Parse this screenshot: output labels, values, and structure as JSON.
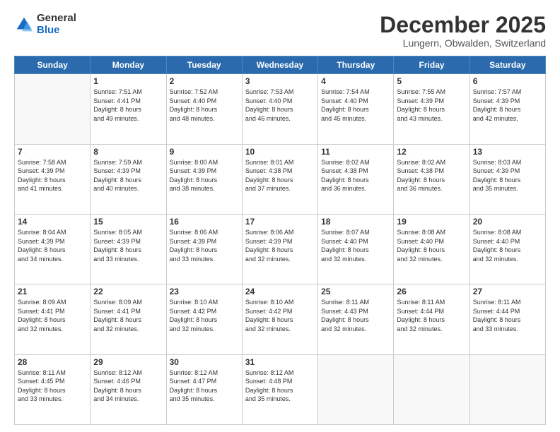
{
  "logo": {
    "general": "General",
    "blue": "Blue"
  },
  "header": {
    "month": "December 2025",
    "location": "Lungern, Obwalden, Switzerland"
  },
  "weekdays": [
    "Sunday",
    "Monday",
    "Tuesday",
    "Wednesday",
    "Thursday",
    "Friday",
    "Saturday"
  ],
  "weeks": [
    [
      {
        "day": "",
        "info": ""
      },
      {
        "day": "1",
        "info": "Sunrise: 7:51 AM\nSunset: 4:41 PM\nDaylight: 8 hours\nand 49 minutes."
      },
      {
        "day": "2",
        "info": "Sunrise: 7:52 AM\nSunset: 4:40 PM\nDaylight: 8 hours\nand 48 minutes."
      },
      {
        "day": "3",
        "info": "Sunrise: 7:53 AM\nSunset: 4:40 PM\nDaylight: 8 hours\nand 46 minutes."
      },
      {
        "day": "4",
        "info": "Sunrise: 7:54 AM\nSunset: 4:40 PM\nDaylight: 8 hours\nand 45 minutes."
      },
      {
        "day": "5",
        "info": "Sunrise: 7:55 AM\nSunset: 4:39 PM\nDaylight: 8 hours\nand 43 minutes."
      },
      {
        "day": "6",
        "info": "Sunrise: 7:57 AM\nSunset: 4:39 PM\nDaylight: 8 hours\nand 42 minutes."
      }
    ],
    [
      {
        "day": "7",
        "info": "Sunrise: 7:58 AM\nSunset: 4:39 PM\nDaylight: 8 hours\nand 41 minutes."
      },
      {
        "day": "8",
        "info": "Sunrise: 7:59 AM\nSunset: 4:39 PM\nDaylight: 8 hours\nand 40 minutes."
      },
      {
        "day": "9",
        "info": "Sunrise: 8:00 AM\nSunset: 4:39 PM\nDaylight: 8 hours\nand 38 minutes."
      },
      {
        "day": "10",
        "info": "Sunrise: 8:01 AM\nSunset: 4:38 PM\nDaylight: 8 hours\nand 37 minutes."
      },
      {
        "day": "11",
        "info": "Sunrise: 8:02 AM\nSunset: 4:38 PM\nDaylight: 8 hours\nand 36 minutes."
      },
      {
        "day": "12",
        "info": "Sunrise: 8:02 AM\nSunset: 4:38 PM\nDaylight: 8 hours\nand 36 minutes."
      },
      {
        "day": "13",
        "info": "Sunrise: 8:03 AM\nSunset: 4:39 PM\nDaylight: 8 hours\nand 35 minutes."
      }
    ],
    [
      {
        "day": "14",
        "info": "Sunrise: 8:04 AM\nSunset: 4:39 PM\nDaylight: 8 hours\nand 34 minutes."
      },
      {
        "day": "15",
        "info": "Sunrise: 8:05 AM\nSunset: 4:39 PM\nDaylight: 8 hours\nand 33 minutes."
      },
      {
        "day": "16",
        "info": "Sunrise: 8:06 AM\nSunset: 4:39 PM\nDaylight: 8 hours\nand 33 minutes."
      },
      {
        "day": "17",
        "info": "Sunrise: 8:06 AM\nSunset: 4:39 PM\nDaylight: 8 hours\nand 32 minutes."
      },
      {
        "day": "18",
        "info": "Sunrise: 8:07 AM\nSunset: 4:40 PM\nDaylight: 8 hours\nand 32 minutes."
      },
      {
        "day": "19",
        "info": "Sunrise: 8:08 AM\nSunset: 4:40 PM\nDaylight: 8 hours\nand 32 minutes."
      },
      {
        "day": "20",
        "info": "Sunrise: 8:08 AM\nSunset: 4:40 PM\nDaylight: 8 hours\nand 32 minutes."
      }
    ],
    [
      {
        "day": "21",
        "info": "Sunrise: 8:09 AM\nSunset: 4:41 PM\nDaylight: 8 hours\nand 32 minutes."
      },
      {
        "day": "22",
        "info": "Sunrise: 8:09 AM\nSunset: 4:41 PM\nDaylight: 8 hours\nand 32 minutes."
      },
      {
        "day": "23",
        "info": "Sunrise: 8:10 AM\nSunset: 4:42 PM\nDaylight: 8 hours\nand 32 minutes."
      },
      {
        "day": "24",
        "info": "Sunrise: 8:10 AM\nSunset: 4:42 PM\nDaylight: 8 hours\nand 32 minutes."
      },
      {
        "day": "25",
        "info": "Sunrise: 8:11 AM\nSunset: 4:43 PM\nDaylight: 8 hours\nand 32 minutes."
      },
      {
        "day": "26",
        "info": "Sunrise: 8:11 AM\nSunset: 4:44 PM\nDaylight: 8 hours\nand 32 minutes."
      },
      {
        "day": "27",
        "info": "Sunrise: 8:11 AM\nSunset: 4:44 PM\nDaylight: 8 hours\nand 33 minutes."
      }
    ],
    [
      {
        "day": "28",
        "info": "Sunrise: 8:11 AM\nSunset: 4:45 PM\nDaylight: 8 hours\nand 33 minutes."
      },
      {
        "day": "29",
        "info": "Sunrise: 8:12 AM\nSunset: 4:46 PM\nDaylight: 8 hours\nand 34 minutes."
      },
      {
        "day": "30",
        "info": "Sunrise: 8:12 AM\nSunset: 4:47 PM\nDaylight: 8 hours\nand 35 minutes."
      },
      {
        "day": "31",
        "info": "Sunrise: 8:12 AM\nSunset: 4:48 PM\nDaylight: 8 hours\nand 35 minutes."
      },
      {
        "day": "",
        "info": ""
      },
      {
        "day": "",
        "info": ""
      },
      {
        "day": "",
        "info": ""
      }
    ]
  ]
}
